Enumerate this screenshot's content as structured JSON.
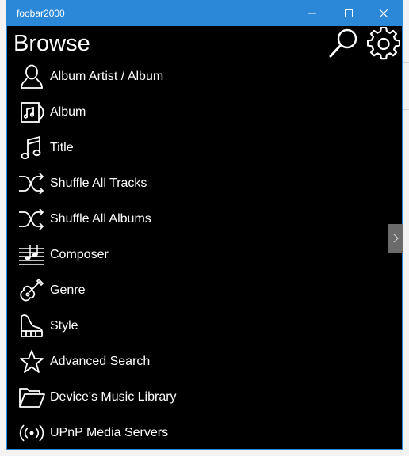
{
  "window": {
    "title": "foobar2000",
    "controls": [
      "minimize",
      "maximize",
      "close"
    ]
  },
  "header": {
    "title": "Browse",
    "search_icon": "search-icon",
    "settings_icon": "gear-icon"
  },
  "menu": {
    "items": [
      {
        "label": "Album Artist / Album",
        "icon": "person-icon"
      },
      {
        "label": "Album",
        "icon": "album-icon"
      },
      {
        "label": "Title",
        "icon": "music-note-icon"
      },
      {
        "label": "Shuffle All Tracks",
        "icon": "shuffle-icon"
      },
      {
        "label": "Shuffle All Albums",
        "icon": "shuffle-icon"
      },
      {
        "label": "Composer",
        "icon": "staff-icon"
      },
      {
        "label": "Genre",
        "icon": "guitar-icon"
      },
      {
        "label": "Style",
        "icon": "piano-icon"
      },
      {
        "label": "Advanced Search",
        "icon": "star-icon"
      },
      {
        "label": "Device's Music Library",
        "icon": "folder-icon"
      },
      {
        "label": "UPnP Media Servers",
        "icon": "broadcast-icon"
      }
    ]
  },
  "colors": {
    "titlebar": "#2b88d8",
    "background": "#000000",
    "text": "#ffffff",
    "side_tab": "#6b6b6b"
  }
}
